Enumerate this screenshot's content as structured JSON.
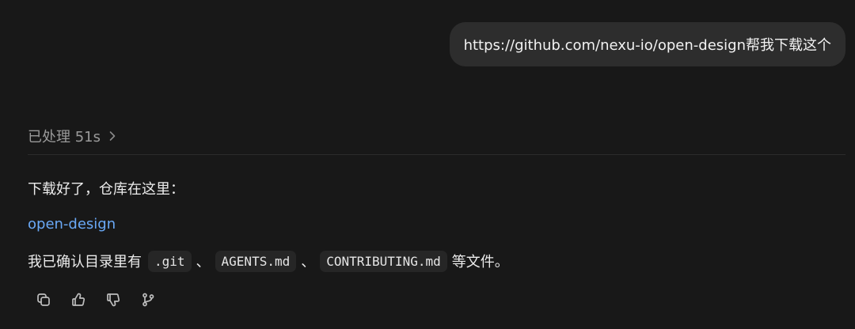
{
  "user_message": {
    "text": "https://github.com/nexu-io/open-design帮我下载这个"
  },
  "processing": {
    "label": "已处理 51s",
    "chevron_icon": "chevron-right-icon"
  },
  "reply": {
    "line1": "下载好了，仓库在这里：",
    "link_text": "open-design",
    "line3_prefix": "我已确认目录里有",
    "files": [
      ".git",
      "AGENTS.md",
      "CONTRIBUTING.md"
    ],
    "separator": "、",
    "line3_suffix": "等文件。"
  },
  "actions": [
    {
      "name": "copy",
      "icon": "copy-icon"
    },
    {
      "name": "thumbs-up",
      "icon": "thumbs-up-icon"
    },
    {
      "name": "thumbs-down",
      "icon": "thumbs-down-icon"
    },
    {
      "name": "branch",
      "icon": "branch-icon"
    }
  ],
  "colors": {
    "background": "#181818",
    "bubble": "#2d2d2d",
    "link": "#6aa9f7",
    "muted": "#9a9a9a",
    "code_bg": "#262626"
  }
}
